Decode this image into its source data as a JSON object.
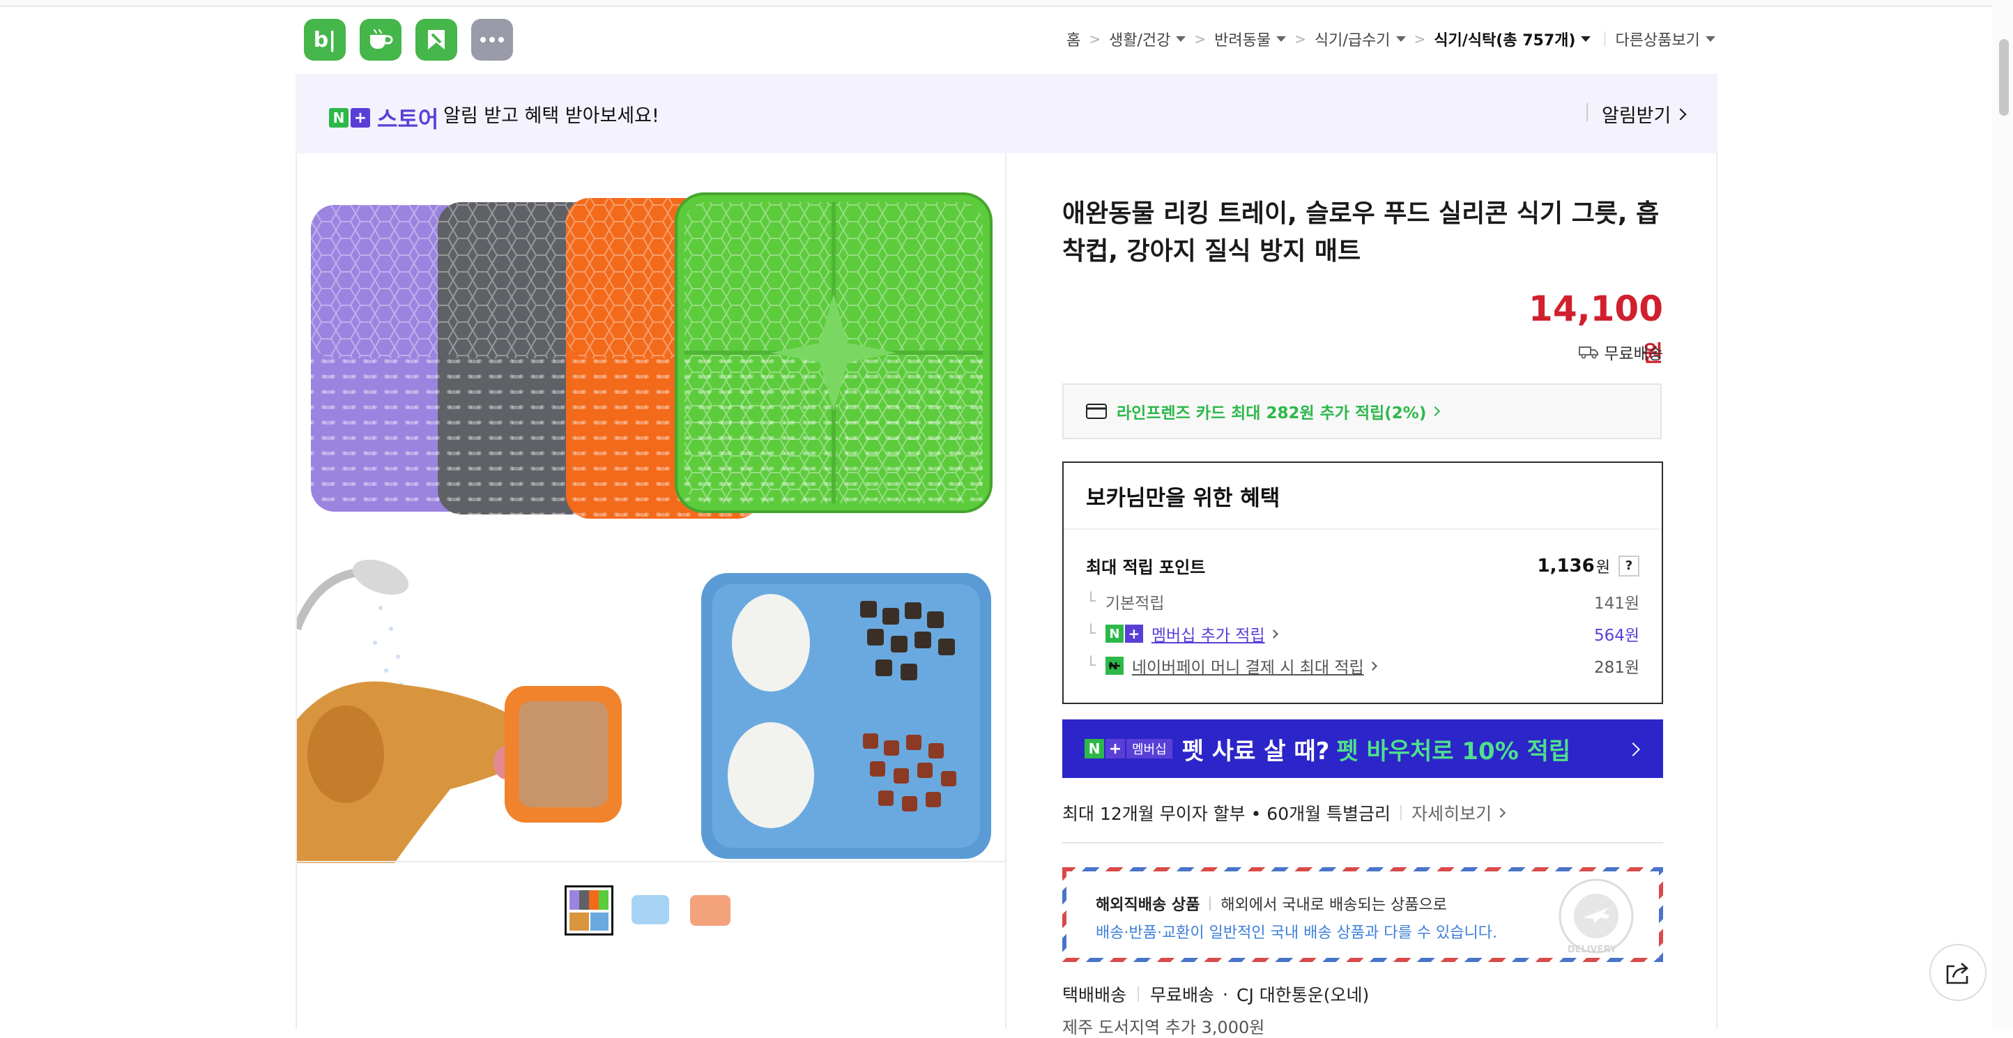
{
  "header": {
    "app_icons": [
      {
        "name": "blog-icon",
        "color": "#45b649",
        "glyph": "b|"
      },
      {
        "name": "cafe-icon",
        "color": "#45b649"
      },
      {
        "name": "bookmark-icon",
        "color": "#45b649"
      },
      {
        "name": "more-apps-icon",
        "color": "#9a9ba8",
        "glyph": "···"
      }
    ],
    "breadcrumb": {
      "home": "홈",
      "items": [
        "생활/건강",
        "반려동물",
        "식기/급수기"
      ],
      "current": "식기/식탁(총 757개)",
      "other": "다른상품보기"
    }
  },
  "banner": {
    "badge_n": "N",
    "badge_plus": "+",
    "store_label": "스토어",
    "text": "알림 받고 혜택 받아보세요!",
    "action": "알림받기"
  },
  "product": {
    "title": "애완동물 리킹 트레이, 슬로우 푸드 실리콘 식기 그릇, 흡착컵, 강아지 질식 방지 매트",
    "price": "14,100",
    "price_unit": "원",
    "shipping": "무료배송",
    "card_offer": "라인프렌즈 카드 최대 282원 추가 적립(2%)"
  },
  "benefit": {
    "title": "보카님만을 위한 혜택",
    "max_points_label": "최대 적립 포인트",
    "max_points_value": "1,136",
    "max_points_unit": "원",
    "help": "?",
    "rows": [
      {
        "label": "기본적립",
        "value": "141원"
      },
      {
        "label": "멤버십 추가 적립",
        "value": "564원"
      },
      {
        "label": "네이버페이 머니 결제 시 최대 적립",
        "value": "281원"
      }
    ]
  },
  "promo": {
    "badge": "멤버십",
    "text_white": "펫 사료 살 때?",
    "text_green": "펫 바우처로 10% 적립"
  },
  "installment": {
    "text": "최대 12개월 무이자 할부 • 60개월 특별금리",
    "link": "자세히보기"
  },
  "overseas": {
    "label": "해외직배송 상품",
    "line1": "해외에서 국내로 배송되는 상품으로",
    "line2": "배송·반품·교환이 일반적인 국내 배송 상품과 다를 수 있습니다.",
    "stamp": "DELIVERY"
  },
  "delivery": {
    "method": "택배배송",
    "fee": "무료배송",
    "courier": "CJ 대한통운(오네)",
    "extra": "제주 도서지역 추가 3,000원"
  },
  "colors": {
    "accent_green": "#2db84a",
    "price_red": "#d0202e",
    "promo_blue": "#2c25c9",
    "membership_purple": "#5a3fd6"
  }
}
